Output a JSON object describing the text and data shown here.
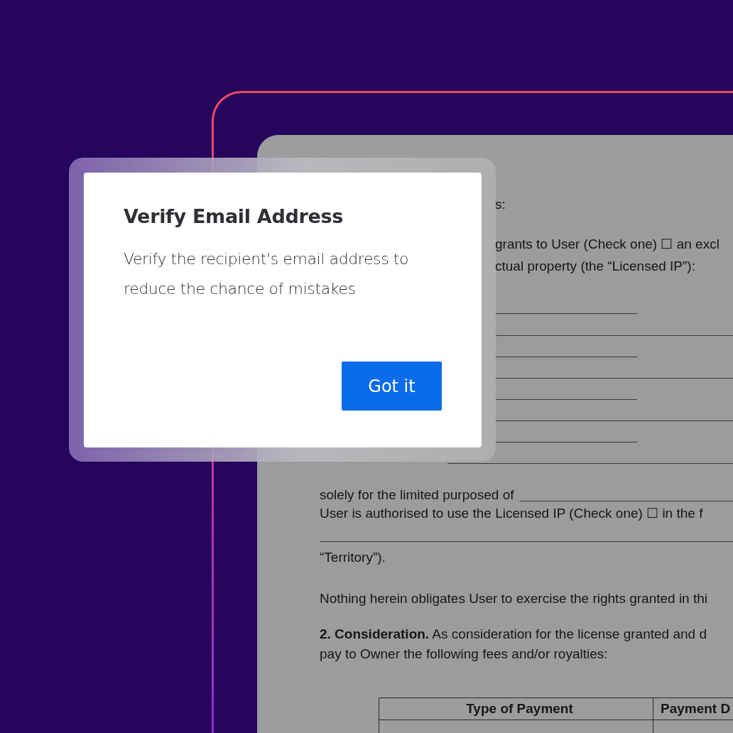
{
  "dialog": {
    "title": "Verify Email Address",
    "message": "Verify the recipient's email address to reduce the chance of mistakes",
    "button": "Got it"
  },
  "document": {
    "lines": [
      {
        "kind": "tail",
        "text": "s:"
      },
      {
        "kind": "tail",
        "text": "grants to User (Check one) ☐ an excl"
      },
      {
        "kind": "tail",
        "text": "ctual property (the “Licensed IP”):"
      },
      {
        "kind": "stub"
      },
      {
        "kind": "rule"
      },
      {
        "kind": "stub"
      },
      {
        "kind": "rule"
      },
      {
        "kind": "stub"
      },
      {
        "kind": "rule"
      },
      {
        "kind": "stub"
      },
      {
        "kind": "gap"
      },
      {
        "kind": "text",
        "text": "solely for the limited purposed of",
        "blank": true
      },
      {
        "kind": "text",
        "text": "User is authorised to use the Licensed IP (Check one) ☐ in the f"
      },
      {
        "kind": "line"
      },
      {
        "kind": "text",
        "text": "“Territory”)."
      },
      {
        "kind": "text",
        "text": "Nothing herein obligates User to exercise the rights granted in thi"
      },
      {
        "kind": "text",
        "text": "**2. Consideration.** As consideration for the license granted and d"
      },
      {
        "kind": "text",
        "text": "pay to Owner the following fees and/or royalties:"
      }
    ],
    "table": {
      "columns": [
        "Type of Payment",
        "Payment D"
      ]
    }
  }
}
